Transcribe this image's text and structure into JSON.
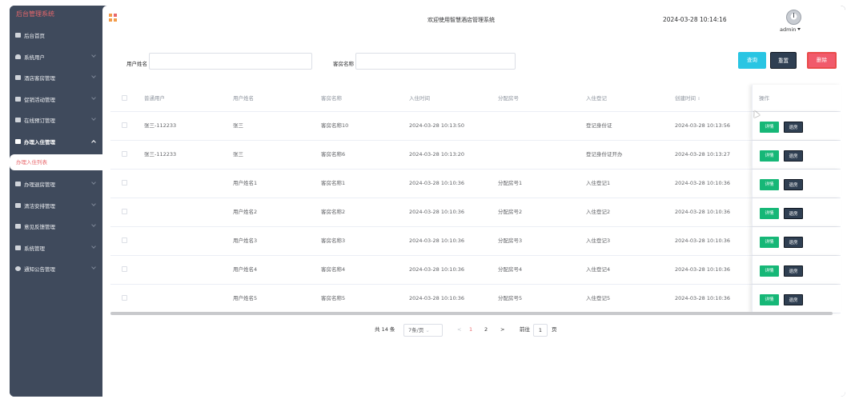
{
  "sidebar": {
    "brand": "后台管理系统",
    "items": [
      {
        "label": "后台首页",
        "icon": "monitor-icon",
        "has_arrow": false
      },
      {
        "label": "系统用户",
        "icon": "user-icon",
        "has_arrow": true
      },
      {
        "label": "酒店客房管理",
        "icon": "grid-icon",
        "has_arrow": true
      },
      {
        "label": "促销活动管理",
        "icon": "grid-icon",
        "has_arrow": true
      },
      {
        "label": "在线预订管理",
        "icon": "grid-icon",
        "has_arrow": true
      },
      {
        "label": "办理入住管理",
        "icon": "grid-icon",
        "has_arrow": true,
        "open": true
      }
    ],
    "active_sub": "办理入住列表",
    "items_after": [
      {
        "label": "办理退房管理",
        "icon": "grid-icon"
      },
      {
        "label": "清洁安排管理",
        "icon": "grid-icon"
      },
      {
        "label": "意见反馈管理",
        "icon": "grid-icon"
      },
      {
        "label": "系统管理",
        "icon": "bar-chart-icon"
      },
      {
        "label": "通知公告管理",
        "icon": "info-icon"
      }
    ]
  },
  "header": {
    "welcome": "欢迎使用智慧酒店管理系统",
    "datetime": "2024-03-28 10:14:16",
    "user": "admin"
  },
  "search": {
    "name_label": "用户姓名",
    "room_label": "客房名称",
    "query_btn": "查询",
    "reset_btn": "重置",
    "delete_btn": "删除"
  },
  "table": {
    "headers": [
      "普通用户",
      "用户姓名",
      "客房名称",
      "入住时间",
      "分配房号",
      "入住登记",
      "创建时间",
      "操作"
    ],
    "rows": [
      [
        "张三-112233",
        "张三",
        "客房名称10",
        "2024-03-28 10:13:50",
        "",
        "登记身份证",
        "2024-03-28 10:13:56"
      ],
      [
        "张三-112233",
        "张三",
        "客房名称6",
        "2024-03-28 10:13:20",
        "",
        "登记身份证开办",
        "2024-03-28 10:13:27"
      ],
      [
        "",
        "用户姓名1",
        "客房名称1",
        "2024-03-28 10:10:36",
        "分配房号1",
        "入住登记1",
        "2024-03-28 10:10:36"
      ],
      [
        "",
        "用户姓名2",
        "客房名称2",
        "2024-03-28 10:10:36",
        "分配房号2",
        "入住登记2",
        "2024-03-28 10:10:36"
      ],
      [
        "",
        "用户姓名3",
        "客房名称3",
        "2024-03-28 10:10:36",
        "分配房号3",
        "入住登记3",
        "2024-03-28 10:10:36"
      ],
      [
        "",
        "用户姓名4",
        "客房名称4",
        "2024-03-28 10:10:36",
        "分配房号4",
        "入住登记4",
        "2024-03-28 10:10:36"
      ],
      [
        "",
        "用户姓名5",
        "客房名称5",
        "2024-03-28 10:10:36",
        "分配房号5",
        "入住登记5",
        "2024-03-28 10:10:36"
      ]
    ],
    "detail_btn": "详情",
    "checkout_btn": "退房"
  },
  "pager": {
    "total": "共 14 条",
    "page_size": "7条/页",
    "prev": "<",
    "page1": "1",
    "page2": "2",
    "next": ">",
    "goto": "前往",
    "goto_value": "1",
    "page_unit": "页"
  },
  "colors": {
    "sidebar_bg": "#3f4a5c",
    "brand_red": "#e8676b",
    "query_btn": "#29c5e3",
    "reset_btn": "#2f3f52",
    "delete_btn": "#f15a6b",
    "detail_btn": "#16b777"
  }
}
